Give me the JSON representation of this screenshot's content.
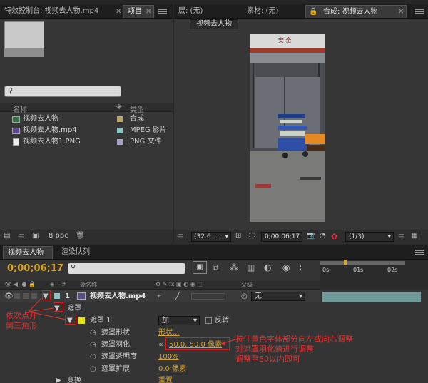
{
  "tabs_top": {
    "effects": "特效控制台: 视频去人物.mp4",
    "project": "项目",
    "layer": "层: (无)",
    "footage": "素材: (无)",
    "comp": "合成: 视频去人物"
  },
  "project": {
    "search_placeholder": "",
    "col_name": "名称",
    "col_type": "类型",
    "items": [
      {
        "name": "视频去人物",
        "type": "合成",
        "color": "#b9a46b"
      },
      {
        "name": "视频去人物.mp4",
        "type": "MPEG 影片",
        "color": "#8fc4c0"
      },
      {
        "name": "视频去人物1.PNG",
        "type": "PNG 文件",
        "color": "#a9a4c7"
      }
    ],
    "bpc": "8 bpc"
  },
  "viewer": {
    "comp_button": "视频去人物",
    "zoom": "(32.6 ...",
    "time": "0;00;06;17",
    "resolution": "(1/3)",
    "image": {
      "sign_text": "安 全"
    }
  },
  "timeline": {
    "tab_comp": "视频去人物",
    "tab_render": "渲染队列",
    "timecode": "0;00;06;17",
    "col_source": "源名称",
    "col_parent": "父级",
    "layer": {
      "index": "1",
      "name": "视频去人物.mp4",
      "parent": "无"
    },
    "mask_group": "遮罩",
    "mask1": "遮罩 1",
    "mode": "加",
    "invert": "反转",
    "props": [
      {
        "name": "遮罩形状",
        "value": "形状..."
      },
      {
        "name": "遮罩羽化",
        "value": "50.0, 50.0 像素"
      },
      {
        "name": "遮罩透明度",
        "value": "100%"
      },
      {
        "name": "遮罩扩展",
        "value": "0.0 像素"
      }
    ],
    "transform": "变换",
    "transform_reset": "重置",
    "ruler": [
      "0s",
      "01s",
      "02s"
    ]
  },
  "notes": {
    "left1": "依次点开",
    "left2": "倒三角形",
    "right1": "按住黄色字体部分向左或向右调整",
    "right2": "对遮罩羽化值进行调整",
    "right3": "调整至50以内即可"
  },
  "colors": {
    "accent": "#d8a42a",
    "annotation": "#e03030",
    "bar": "#6f9c98"
  }
}
